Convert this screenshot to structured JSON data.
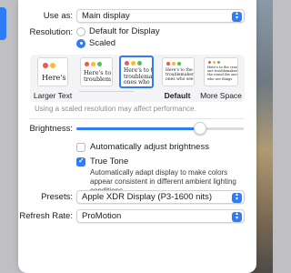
{
  "display_settings": {
    "use_as": {
      "label": "Use as:",
      "value": "Main display"
    },
    "resolution": {
      "label": "Resolution:",
      "options": [
        {
          "label": "Default for Display",
          "selected": false
        },
        {
          "label": "Scaled",
          "selected": true
        }
      ],
      "scale_choices": [
        {
          "preview_text": "Here's",
          "caption": "Larger Text",
          "selected": false
        },
        {
          "preview_text": "Here's to troublem",
          "caption": "",
          "selected": false
        },
        {
          "preview_text": "Here's to t troublemak ones who",
          "caption": "",
          "selected": true
        },
        {
          "preview_text": "Here's to the troublemakers, ones who see t",
          "caption": "Default",
          "selected": false
        },
        {
          "preview_text": "Here's to the crazy one troublemakers, the round the ones who see things",
          "caption": "More Space",
          "selected": false
        }
      ],
      "hint": "Using a scaled resolution may affect performance."
    },
    "brightness": {
      "label": "Brightness:",
      "level": 0.74
    },
    "auto_brightness": {
      "label": "Automatically adjust brightness",
      "checked": false
    },
    "true_tone": {
      "label": "True Tone",
      "checked": true,
      "description": "Automatically adapt display to make colors appear consistent in different ambient lighting conditions."
    },
    "presets": {
      "label": "Presets:",
      "value": "Apple XDR Display (P3-1600 nits)"
    },
    "refresh_rate": {
      "label": "Refresh Rate:",
      "value": "ProMotion"
    }
  },
  "colors": {
    "accent": "#2f7cf6",
    "dot_red": "#f2574f",
    "dot_yellow": "#f6bb3a",
    "dot_green": "#4fc34b"
  }
}
